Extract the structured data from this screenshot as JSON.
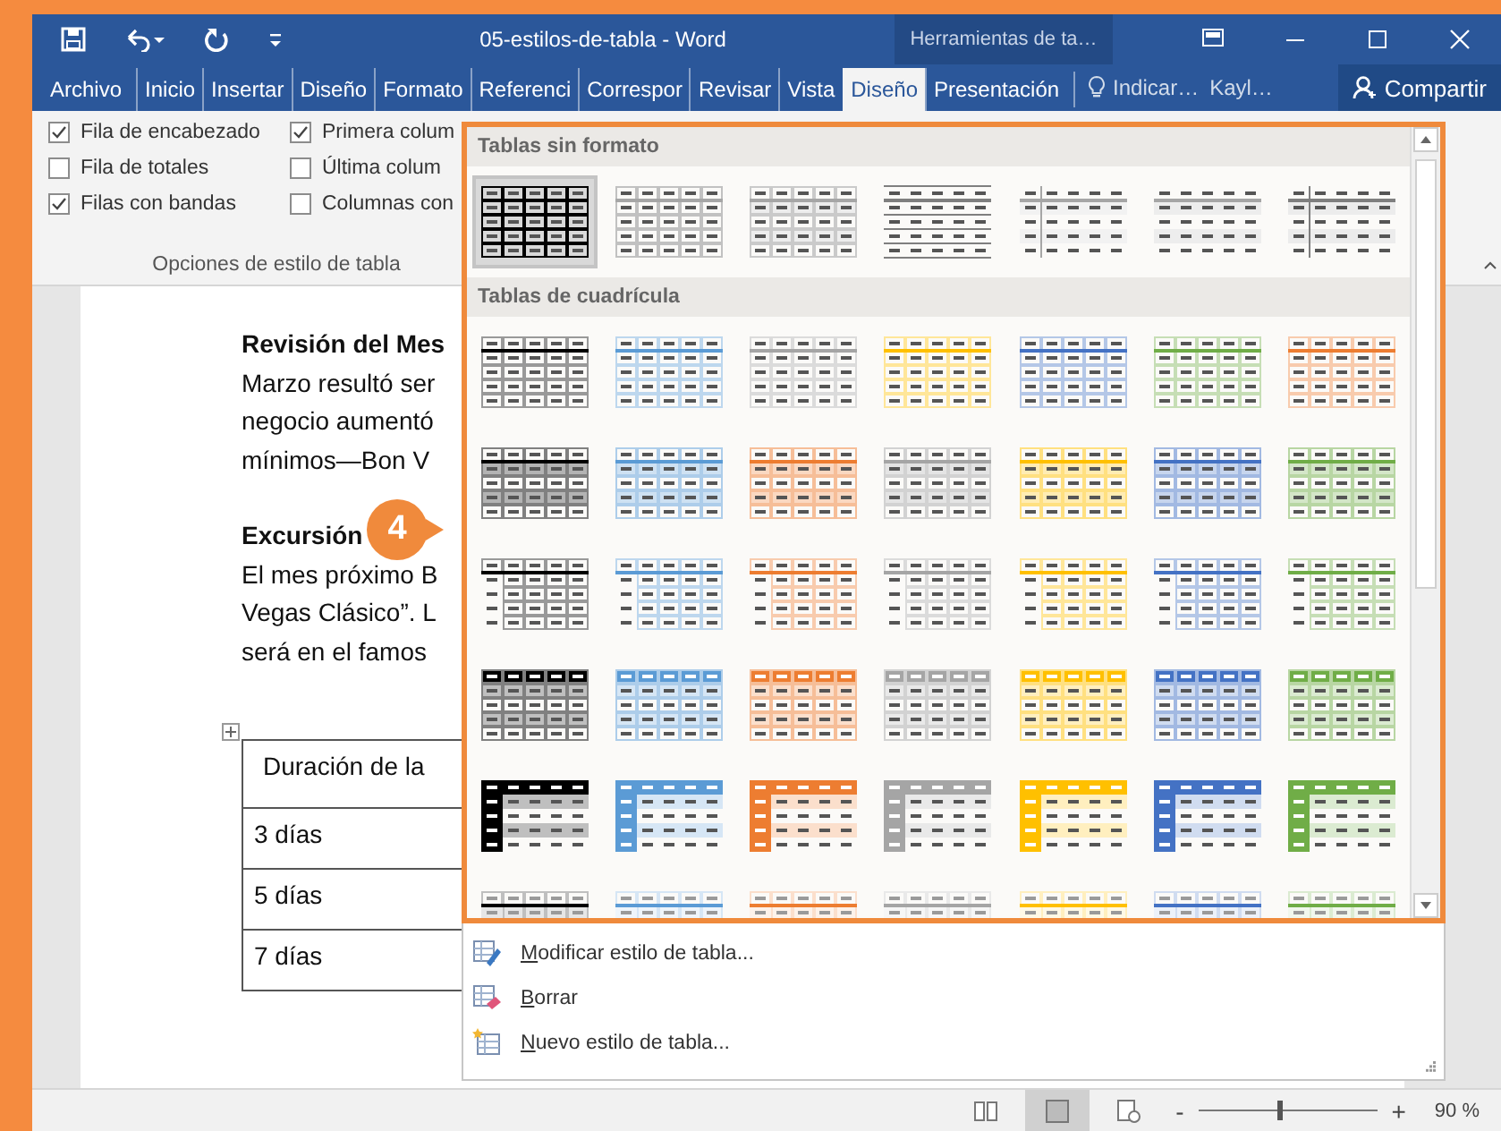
{
  "window": {
    "title": "05-estilos-de-tabla - Word",
    "contextual_title": "Herramientas de ta…"
  },
  "tabs": [
    {
      "label": "Archivo",
      "selected": false
    },
    {
      "label": "Inicio",
      "selected": false
    },
    {
      "label": "Insertar",
      "selected": false
    },
    {
      "label": "Diseño",
      "selected": false
    },
    {
      "label": "Formato",
      "selected": false
    },
    {
      "label": "Referenci",
      "selected": false
    },
    {
      "label": "Correspor",
      "selected": false
    },
    {
      "label": "Revisar",
      "selected": false
    },
    {
      "label": "Vista",
      "selected": false
    },
    {
      "label": "Diseño",
      "selected": true
    },
    {
      "label": "Presentación",
      "selected": false
    }
  ],
  "tell_me": "Indicar…",
  "user": "Kayl…",
  "share": "Compartir",
  "style_options": {
    "group_label": "Opciones de estilo de tabla",
    "checkboxes": [
      {
        "label": "Fila de encabezado",
        "checked": true
      },
      {
        "label": "Primera colum",
        "checked": true
      },
      {
        "label": "Fila de totales",
        "checked": false
      },
      {
        "label": "Última colum",
        "checked": false
      },
      {
        "label": "Filas con bandas",
        "checked": true
      },
      {
        "label": "Columnas con",
        "checked": false
      }
    ]
  },
  "document": {
    "paragraphs": [
      {
        "heading": "Revisión del Mes",
        "lines": [
          "Marzo resultó ser",
          "negocio aumentó",
          "mínimos—Bon V"
        ]
      },
      {
        "heading": "Excursión",
        "lines": [
          "El mes próximo B",
          "Vegas Clásico”. L",
          "será en el famos"
        ]
      }
    ],
    "table": {
      "rows": [
        "Duración de la",
        "3 días",
        "5 días",
        "7 días"
      ]
    }
  },
  "step_badge": "4",
  "gallery": {
    "sections": [
      {
        "title": "Tablas sin formato",
        "rows": [
          [
            {
              "kind": "plain-grid",
              "color": "#000000",
              "selected": true
            },
            {
              "kind": "plain-light-grid",
              "color": "#a6a6a6",
              "selected": false
            },
            {
              "kind": "plain-banded-grid",
              "color": "#a6a6a6",
              "selected": false
            },
            {
              "kind": "plain-lines",
              "color": "#7f7f7f",
              "selected": false
            },
            {
              "kind": "plain-first-col",
              "color": "#a6a6a6",
              "selected": false
            },
            {
              "kind": "plain-banded",
              "color": "#a6a6a6",
              "selected": false
            },
            {
              "kind": "plain-first-col",
              "color": "#7f7f7f",
              "selected": false
            }
          ]
        ]
      },
      {
        "title": "Tablas de cuadrícula",
        "rows": [
          [
            {
              "kind": "grid-light",
              "color": "#000000",
              "selected": false
            },
            {
              "kind": "grid-light",
              "color": "#5b9bd5",
              "selected": false
            },
            {
              "kind": "grid-light",
              "color": "#a5a5a5",
              "selected": false
            },
            {
              "kind": "grid-light",
              "color": "#ffc000",
              "selected": false
            },
            {
              "kind": "grid-light",
              "color": "#4472c4",
              "selected": false
            },
            {
              "kind": "grid-light",
              "color": "#70ad47",
              "selected": false
            },
            {
              "kind": "grid-light",
              "color": "#ed7d31",
              "selected": false
            }
          ],
          [
            {
              "kind": "grid-banded",
              "color": "#000000",
              "selected": false
            },
            {
              "kind": "grid-banded",
              "color": "#5b9bd5",
              "selected": false
            },
            {
              "kind": "grid-banded",
              "color": "#ed7d31",
              "selected": false
            },
            {
              "kind": "grid-banded",
              "color": "#a5a5a5",
              "selected": false
            },
            {
              "kind": "grid-banded",
              "color": "#ffc000",
              "selected": false
            },
            {
              "kind": "grid-banded",
              "color": "#4472c4",
              "selected": false
            },
            {
              "kind": "grid-banded",
              "color": "#70ad47",
              "selected": false
            }
          ],
          [
            {
              "kind": "grid-first-col",
              "color": "#000000",
              "selected": false
            },
            {
              "kind": "grid-first-col",
              "color": "#5b9bd5",
              "selected": false
            },
            {
              "kind": "grid-first-col",
              "color": "#ed7d31",
              "selected": false
            },
            {
              "kind": "grid-first-col",
              "color": "#a5a5a5",
              "selected": false
            },
            {
              "kind": "grid-first-col",
              "color": "#ffc000",
              "selected": false
            },
            {
              "kind": "grid-first-col",
              "color": "#4472c4",
              "selected": false
            },
            {
              "kind": "grid-first-col",
              "color": "#70ad47",
              "selected": false
            }
          ],
          [
            {
              "kind": "grid-header",
              "color": "#000000",
              "selected": false
            },
            {
              "kind": "grid-header",
              "color": "#5b9bd5",
              "selected": false
            },
            {
              "kind": "grid-header",
              "color": "#ed7d31",
              "selected": false
            },
            {
              "kind": "grid-header",
              "color": "#a5a5a5",
              "selected": false
            },
            {
              "kind": "grid-header",
              "color": "#ffc000",
              "selected": false
            },
            {
              "kind": "grid-header",
              "color": "#4472c4",
              "selected": false
            },
            {
              "kind": "grid-header",
              "color": "#70ad47",
              "selected": false
            }
          ],
          [
            {
              "kind": "grid-accent",
              "color": "#000000",
              "selected": false
            },
            {
              "kind": "grid-accent",
              "color": "#5b9bd5",
              "selected": false
            },
            {
              "kind": "grid-accent",
              "color": "#ed7d31",
              "selected": false
            },
            {
              "kind": "grid-accent",
              "color": "#a5a5a5",
              "selected": false
            },
            {
              "kind": "grid-accent",
              "color": "#ffc000",
              "selected": false
            },
            {
              "kind": "grid-accent",
              "color": "#4472c4",
              "selected": false
            },
            {
              "kind": "grid-accent",
              "color": "#70ad47",
              "selected": false
            }
          ],
          [
            {
              "kind": "grid-faint",
              "color": "#000000",
              "selected": false
            },
            {
              "kind": "grid-faint",
              "color": "#5b9bd5",
              "selected": false
            },
            {
              "kind": "grid-faint",
              "color": "#ed7d31",
              "selected": false
            },
            {
              "kind": "grid-faint",
              "color": "#a5a5a5",
              "selected": false
            },
            {
              "kind": "grid-faint",
              "color": "#ffc000",
              "selected": false
            },
            {
              "kind": "grid-faint",
              "color": "#4472c4",
              "selected": false
            },
            {
              "kind": "grid-faint",
              "color": "#70ad47",
              "selected": false
            }
          ]
        ]
      }
    ]
  },
  "menu": [
    {
      "kind": "modify",
      "label": "Modificar estilo de tabla..."
    },
    {
      "kind": "clear",
      "label": "Borrar"
    },
    {
      "kind": "new",
      "label": "Nuevo estilo de tabla..."
    }
  ],
  "status_bar": {
    "views": [
      {
        "kind": "read",
        "selected": false
      },
      {
        "kind": "print",
        "selected": true
      },
      {
        "kind": "web",
        "selected": false
      }
    ],
    "zoom": {
      "minus": "-",
      "plus": "+",
      "level": 0.45,
      "reading": "90 %"
    }
  }
}
